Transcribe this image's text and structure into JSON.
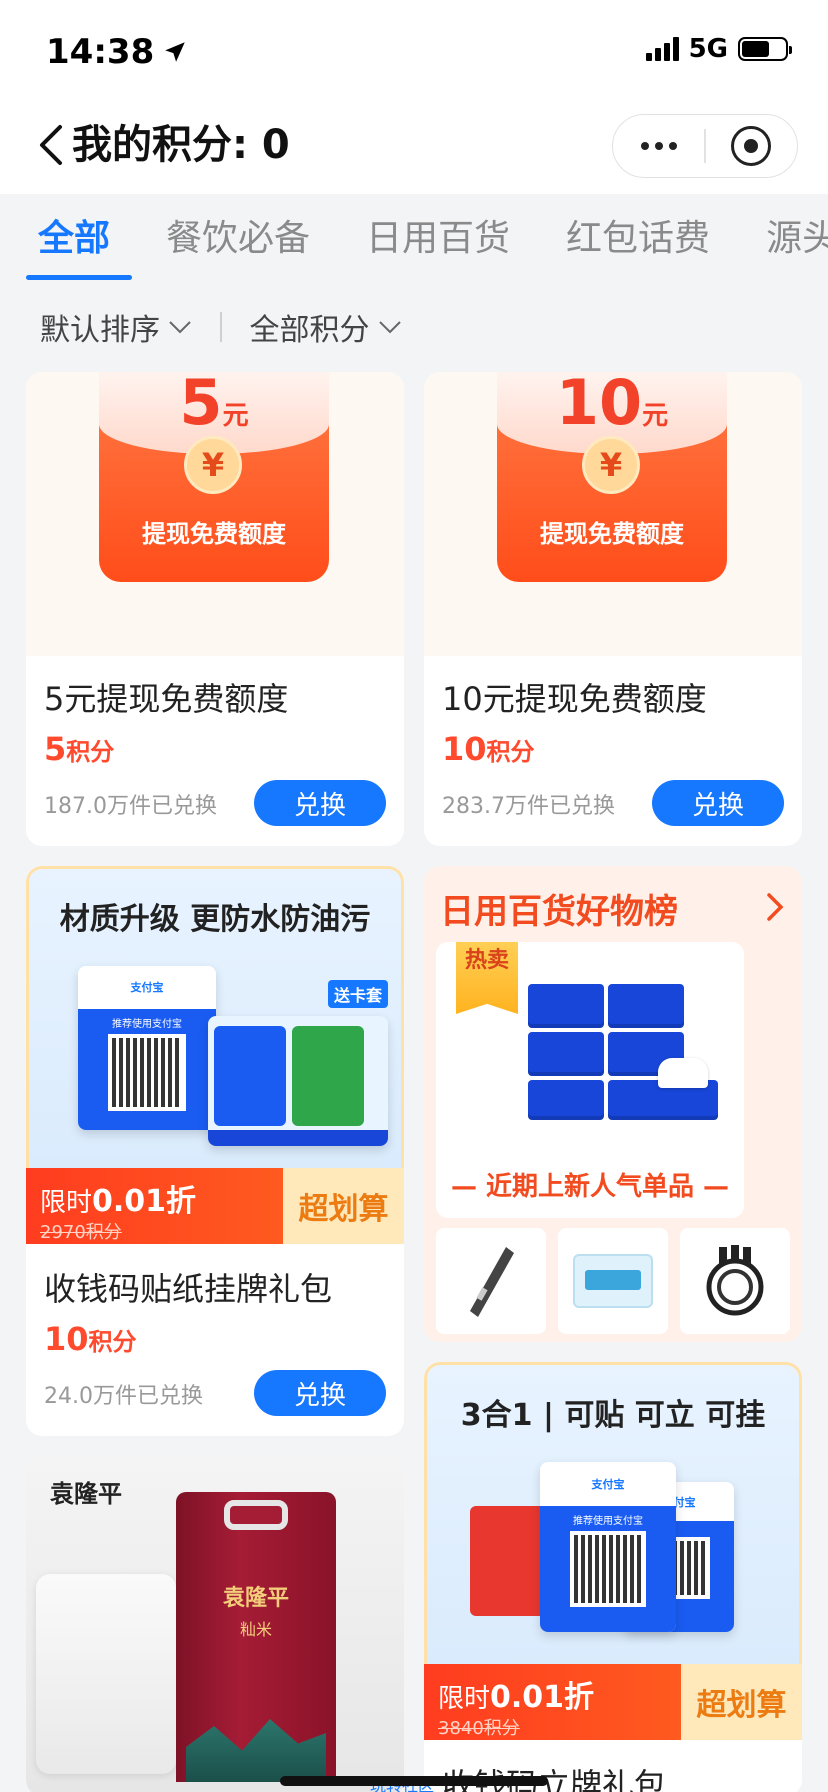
{
  "status_bar": {
    "time": "14:38",
    "network": "5G",
    "battery_level": 0.65
  },
  "nav": {
    "title": "我的积分: 0"
  },
  "tabs": [
    {
      "label": "全部",
      "active": true
    },
    {
      "label": "餐饮必备",
      "active": false
    },
    {
      "label": "日用百货",
      "active": false
    },
    {
      "label": "红包话费",
      "active": false
    },
    {
      "label": "源头",
      "active": false
    }
  ],
  "filters": {
    "sort": "默认排序",
    "points": "全部积分"
  },
  "products": {
    "p1": {
      "art_amount": "5",
      "art_unit": "元",
      "art_label": "提现免费额度",
      "name": "5元提现免费额度",
      "points": "5",
      "points_unit": "积分",
      "sold": "187.0万件已兑换",
      "button": "兑换"
    },
    "p2": {
      "art_amount": "10",
      "art_unit": "元",
      "art_label": "提现免费额度",
      "name": "10元提现免费额度",
      "points": "10",
      "points_unit": "积分",
      "sold": "283.7万件已兑换",
      "button": "兑换"
    },
    "p3": {
      "art_title": "材质升级 更防水防油污",
      "art_tag": "送卡套",
      "qr_brand": "支付宝",
      "qr_text": "推荐使用支付宝",
      "deal_prefix": "限时",
      "deal_value": "0.01折",
      "deal_original": "2970积分",
      "deal_badge": "超划算",
      "name": "收钱码贴纸挂牌礼包",
      "points": "10",
      "points_unit": "积分",
      "sold": "24.0万件已兑换",
      "button": "兑换"
    },
    "p5": {
      "art_logo": "袁隆平",
      "art_bag_name": "袁隆平",
      "art_bag_sub": "籼米"
    },
    "p6": {
      "art_title": "3合1 | 可贴 可立 可挂",
      "qr_brand": "支付宝",
      "qr_text": "推荐使用支付宝",
      "deal_prefix": "限时",
      "deal_value": "0.01折",
      "deal_original": "3840积分",
      "deal_badge": "超划算",
      "name": "收钱码立牌礼包"
    }
  },
  "goods_list": {
    "title": "日用百货好物榜",
    "hot_tag": "热卖",
    "subtitle": "— 近期上新人气单品 —"
  },
  "bottom_peek": "玩转社区"
}
